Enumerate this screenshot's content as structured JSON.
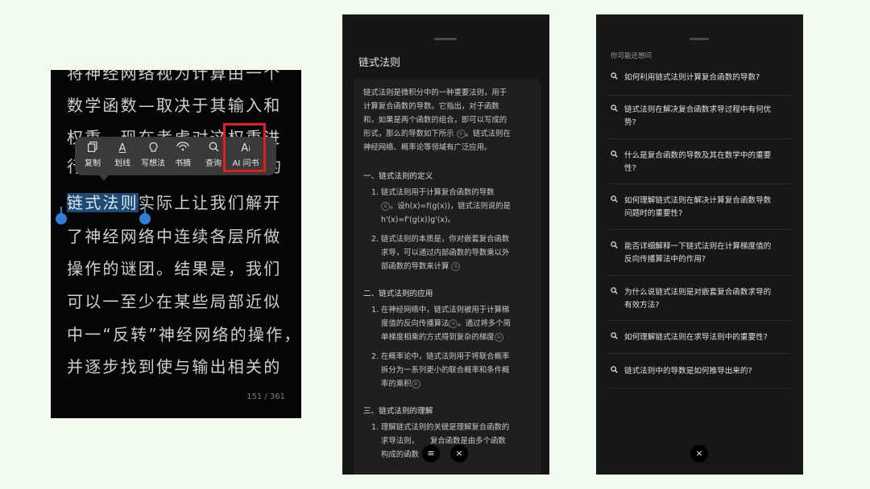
{
  "reader": {
    "lines": [
      "将神经网络视为计算由一个",
      "数学函数—取决于其输入和",
      "权重。现在考虑对这权重进",
      "行",
      "的"
    ],
    "highlight_text": "链式法则",
    "highlight_rest": "实际上让我们解开",
    "line6": "了神经网络中连续各层所做",
    "line7": "操作的谜团。结果是，我们",
    "line8": "可以一至少在某些局部近似",
    "line9": "中一“反转”神经网络的操作，",
    "line10": "并逐步找到使与输出相关的",
    "page_indicator": "151 / 361",
    "menu": [
      {
        "label": "复制",
        "icon": "copy-icon"
      },
      {
        "label": "划线",
        "icon": "underline-icon"
      },
      {
        "label": "写想法",
        "icon": "idea-icon"
      },
      {
        "label": "书摘",
        "icon": "bookmark-icon"
      },
      {
        "label": "查询",
        "icon": "search-icon"
      },
      {
        "label": "AI 问书",
        "icon": "ai-icon"
      }
    ],
    "highlight_color": "#1f4a72",
    "handle_color": "#2f7fd6",
    "callout_color": "#e02020"
  },
  "detail": {
    "title": "链式法则",
    "intro": [
      "链式法则是微积分中的一种重要法则，用于",
      "计算复合函数的导数。它指出，对于函数",
      "和，如果是两个函数的组合，即可以写成的",
      "形式，那么的导数如下所示",
      "神经网络、概率论等领域有广泛应用。"
    ],
    "intro_tail": "。链式法则在",
    "sec1": "一、链式法则的定义",
    "s1i1": [
      "1. 链式法则用于计算复合函数的导数",
      "。设h(x)=f(g(x))，链式法则说的是",
      "h'(x)=f'(g(x))g'(x)。"
    ],
    "s1i2": [
      "2. 链式法则的本质是，你对嵌套复合函数",
      "求导，可以通过内部函数的导数乘以外",
      "部函数的导数来计算"
    ],
    "sec2": "二、链式法则的应用",
    "s2i1": [
      "1. 在神经网络中，链式法则被用于计算梯",
      "度值的反向传播算法",
      "。通过将多个简",
      "单梯度相乘的方式得到复杂的梯度"
    ],
    "s2i2": [
      "2. 在概率论中，链式法则用于将联合概率",
      "拆分为一系列更小的联合概率和条件概",
      "率的乘积"
    ],
    "sec3": "三、链式法则的理解",
    "s3i1": [
      "1. 理解链式法则的关键是理解复合函数的",
      "求导法则，",
      "复合函数是由多个函数",
      "构成的函数"
    ],
    "ref_mark": "①",
    "menu_button": "≡",
    "close_button": "×"
  },
  "suggestions": {
    "heading": "你可能还想问",
    "questions": [
      [
        "如何利用链式法则计算复合函数的导数?"
      ],
      [
        "链式法则在解决复合函数求导过程中有何优",
        "势?"
      ],
      [
        "什么是复合函数的导数及其在数学中的重要",
        "性?"
      ],
      [
        "如何理解链式法则在解决计算复合函数导数",
        "问题时的重要性?"
      ],
      [
        "能否详细解释一下链式法则在计算梯度值的",
        "反向传播算法中的作用?"
      ],
      [
        "为什么说链式法则是对嵌套复合函数求导的",
        "有效方法?"
      ],
      [
        "如何理解链式法则在求导法则中的重要性?"
      ],
      [
        "链式法则中的导数是如何推导出来的?"
      ]
    ],
    "close_button": "×"
  }
}
